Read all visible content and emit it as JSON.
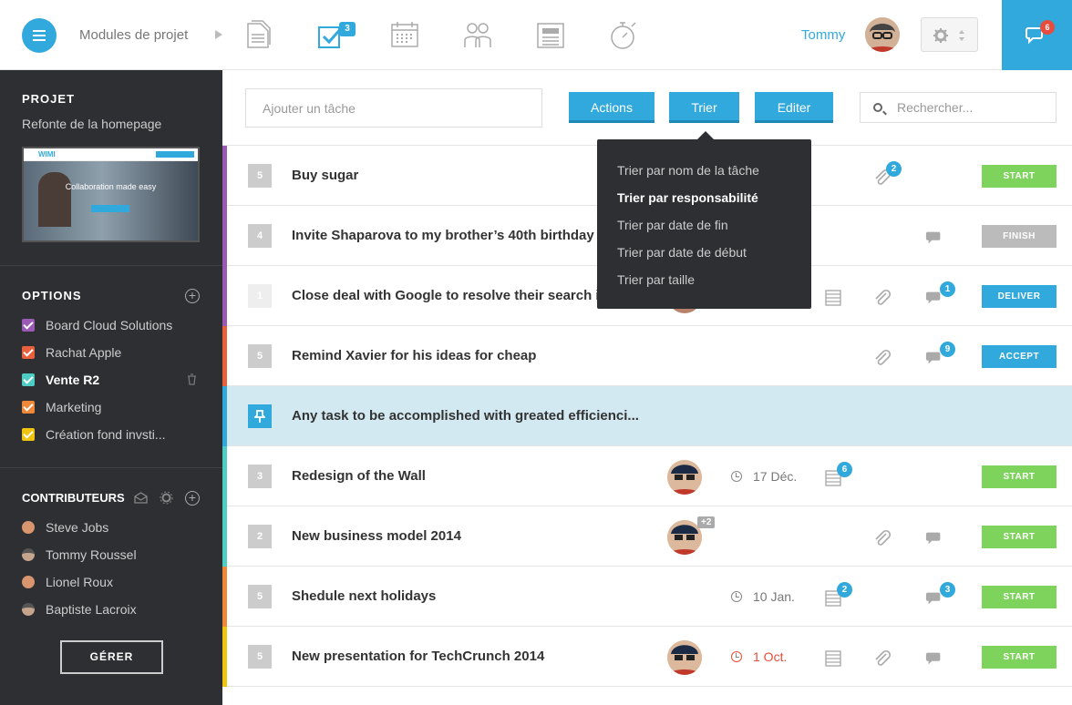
{
  "header": {
    "breadcrumb": "Modules de projet",
    "modules": [
      {
        "icon": "documents-icon",
        "active": false
      },
      {
        "icon": "tasks-check-icon",
        "active": true,
        "badge": "3"
      },
      {
        "icon": "calendar-icon",
        "active": false
      },
      {
        "icon": "team-icon",
        "active": false
      },
      {
        "icon": "news-icon",
        "active": false
      },
      {
        "icon": "stopwatch-icon",
        "active": false
      }
    ],
    "user_name": "Tommy",
    "chat_badge": "6"
  },
  "sidebar": {
    "project_heading": "PROJET",
    "project_name": "Refonte de la homepage",
    "thumbnail_caption": "Collaboration made easy",
    "thumbnail_logo": "WIMI",
    "options_heading": "OPTIONS",
    "options": [
      {
        "label": "Board Cloud Solutions",
        "color": "#9b59b6"
      },
      {
        "label": "Rachat Apple",
        "color": "#e8603c"
      },
      {
        "label": "Vente R2",
        "color": "#4ecdc4",
        "active": true
      },
      {
        "label": "Marketing",
        "color": "#f0883a"
      },
      {
        "label": "Création fond invsti...",
        "color": "#f1c40f"
      }
    ],
    "contributors_heading": "CONTRIBUTEURS",
    "contributors": [
      "Steve Jobs",
      "Tommy Roussel",
      "Lionel Roux",
      "Baptiste Lacroix"
    ],
    "manage_label": "GÉRER"
  },
  "toolbar": {
    "task_placeholder": "Ajouter un tâche",
    "actions_label": "Actions",
    "sort_label": "Trier",
    "edit_label": "Editer",
    "search_placeholder": "Rechercher..."
  },
  "sort_menu": [
    "Trier par nom de la tâche",
    "Trier par responsabilité",
    "Trier par date de fin",
    "Trier par date de début",
    "Trier par taille"
  ],
  "tasks": [
    {
      "num": "5",
      "title": "Buy sugar",
      "status": "START",
      "status_color": "#7ed35d",
      "stripe": "#9b59b6",
      "attach_badge": "2"
    },
    {
      "num": "4",
      "title": "Invite Shaparova to my brother’s 40th birthday party",
      "status": "FINISH",
      "status_color": "#bbbbbb",
      "stripe": "#9b59b6"
    },
    {
      "num": "1",
      "title": "Close deal with Google to resolve their search issue",
      "status": "DELIVER",
      "status_color": "#32a9dc",
      "stripe": "#9b59b6",
      "comment_badge": "1"
    },
    {
      "num": "5",
      "title": "Remind Xavier for his ideas for cheap",
      "status": "ACCEPT",
      "status_color": "#32a9dc",
      "stripe": "#e8603c",
      "comment_badge": "9"
    },
    {
      "title": "Any task to be accomplished with greated efficienci...",
      "stripe": "#32a9dc"
    },
    {
      "num": "3",
      "title": "Redesign of the Wall",
      "status": "START",
      "status_color": "#7ed35d",
      "stripe": "#4ecdc4",
      "date": "17 Déc.",
      "list_badge": "6"
    },
    {
      "num": "2",
      "title": "New business model 2014",
      "status": "START",
      "status_color": "#7ed35d",
      "stripe": "#4ecdc4",
      "extra": "+2"
    },
    {
      "num": "5",
      "title": "Shedule next holidays",
      "status": "START",
      "status_color": "#7ed35d",
      "stripe": "#f0883a",
      "date": "10 Jan.",
      "list_badge": "2",
      "comment_badge": "3"
    },
    {
      "num": "5",
      "title": "New presentation for TechCrunch 2014",
      "status": "START",
      "status_color": "#7ed35d",
      "stripe": "#f1c40f",
      "date": "1 Oct.",
      "date_color": "#e74c3c"
    }
  ]
}
